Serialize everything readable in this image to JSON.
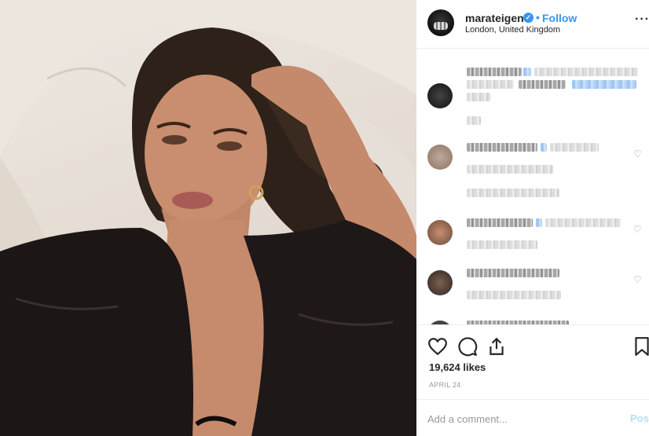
{
  "post": {
    "username": "marateigen",
    "verified_mark": "✓",
    "separator": "•",
    "follow_label": "Follow",
    "location": "London, United Kingdom",
    "more_label": "···",
    "likes": "19,624 likes",
    "date": "APRIL 24",
    "comment_placeholder": "Add a comment...",
    "post_label": "Post"
  },
  "icons": {
    "like": "heart-icon",
    "comment": "comment-icon",
    "share": "share-icon",
    "save": "bookmark-icon",
    "comment_like": "heart-icon"
  },
  "colors": {
    "accent": "#3897f0",
    "text": "#262626",
    "muted": "#999999",
    "border": "#efefef"
  }
}
